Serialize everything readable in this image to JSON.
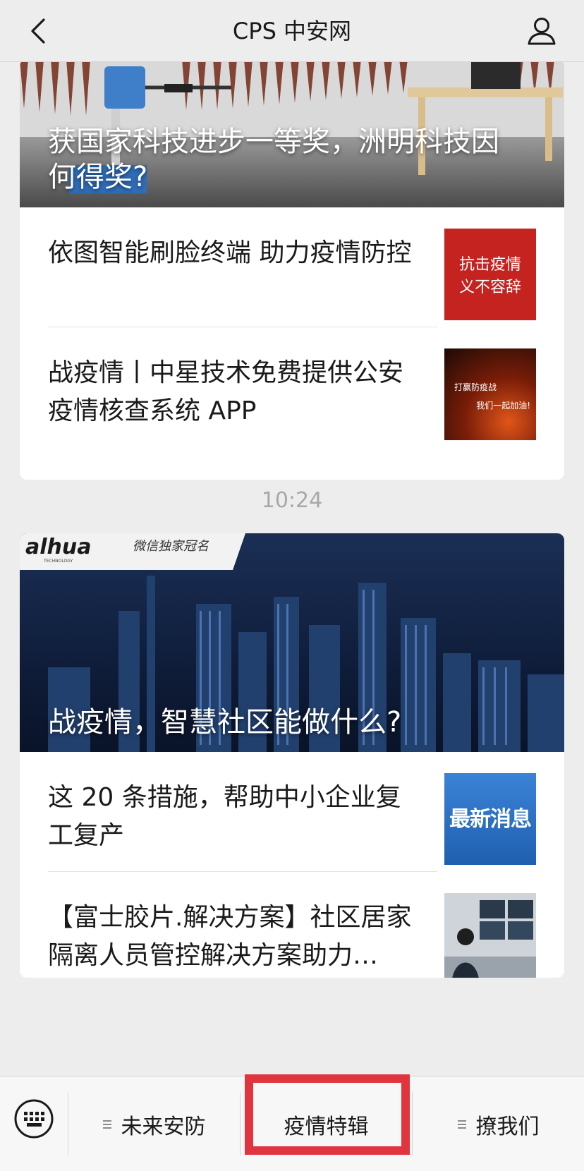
{
  "navbar": {
    "title": "CPS 中安网",
    "back_icon": "chevron-left-icon",
    "user_icon": "person-icon"
  },
  "groups": [
    {
      "cover_title": "获国家科技进步一等奖，洲明科技因何得奖?",
      "items": [
        {
          "title": "依图智能刷脸终端 助力疫情防控",
          "thumb_text": "抗击疫情\n义不容辞"
        },
        {
          "title": "战疫情丨中星技术免费提供公安疫情核查系统 APP",
          "thumb_text_a": "打赢防疫战",
          "thumb_text_b": "我们一起加油!"
        }
      ]
    },
    {
      "timestamp": "10:24",
      "cover_brand": "alhua",
      "cover_brand_sub": "TECHNOLOGY",
      "cover_badge": "微信独家冠名",
      "cover_title": "战疫情，智慧社区能做什么?",
      "items": [
        {
          "title": "这 20 条措施，帮助中小企业复工复产",
          "thumb_text": "最新消息"
        },
        {
          "title": "【富士胶片.解决方案】社区居家隔离人员管控解决方案助力…"
        }
      ]
    }
  ],
  "menu": {
    "keyboard_icon": "keyboard-icon",
    "items": [
      {
        "label": "未来安防"
      },
      {
        "label": "疫情特辑"
      },
      {
        "label": "撩我们"
      }
    ]
  },
  "colors": {
    "background": "#ededed",
    "highlight": "#e0353f",
    "card": "#ffffff"
  }
}
